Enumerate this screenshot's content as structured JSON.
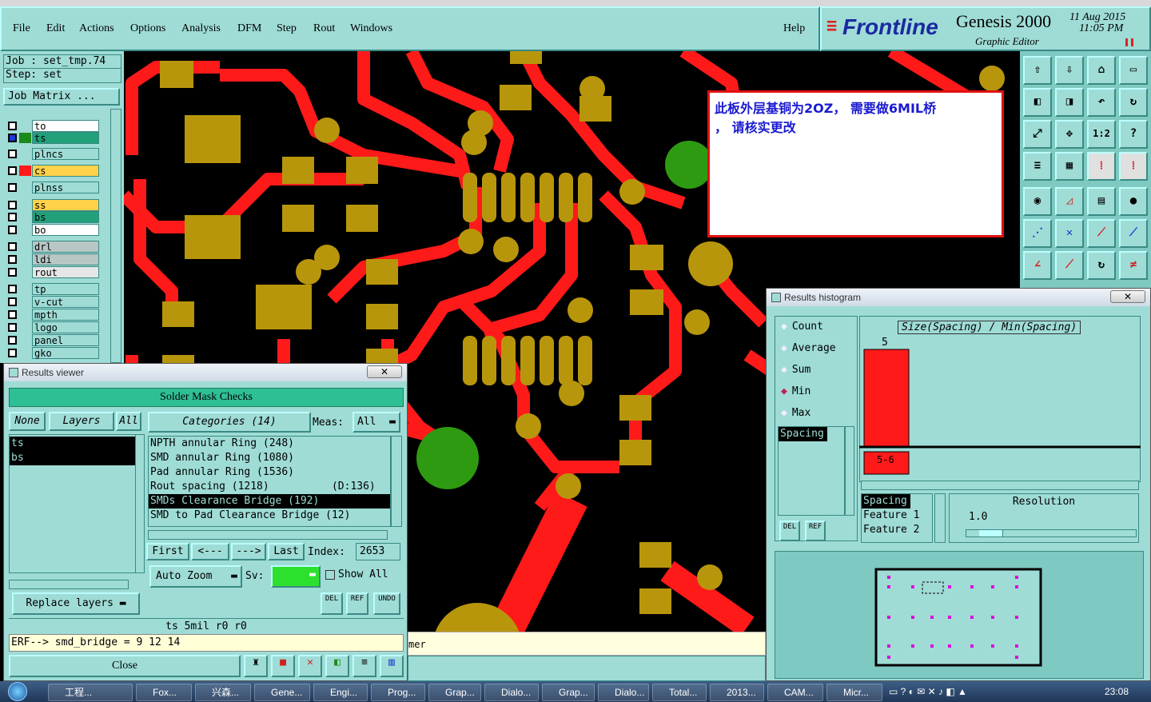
{
  "menu": {
    "file": "File",
    "edit": "Edit",
    "actions": "Actions",
    "options": "Options",
    "analysis": "Analysis",
    "dfm": "DFM",
    "step": "Step",
    "rout": "Rout",
    "windows": "Windows",
    "help": "Help"
  },
  "brand": {
    "logo": "Frontline",
    "product": "Genesis 2000",
    "subtitle": "Graphic Editor",
    "date": "11 Aug 2015",
    "time": "11:05 PM"
  },
  "left": {
    "job": "Job : set_tmp.74",
    "step": "Step: set",
    "job_matrix": "Job Matrix ...",
    "layers": [
      {
        "name": "to",
        "color": "#ffffff"
      },
      {
        "name": "ts",
        "color": "#22a07a"
      },
      {
        "name": "plncs",
        "color": "#9fdcd6"
      },
      {
        "name": "cs",
        "color": "#ffd24a"
      },
      {
        "name": "plnss",
        "color": "#9fdcd6"
      },
      {
        "name": "ss",
        "color": "#ffd24a"
      },
      {
        "name": "bs",
        "color": "#22a07a"
      },
      {
        "name": "bo",
        "color": "#ffffff"
      },
      {
        "name": "drl",
        "color": "#b8c6c6"
      },
      {
        "name": "ldi",
        "color": "#b8c6c6"
      },
      {
        "name": "rout",
        "color": "#e6e6e6"
      },
      {
        "name": "tp",
        "color": "#9fdcd6"
      },
      {
        "name": "v-cut",
        "color": "#9fdcd6"
      },
      {
        "name": "mpth",
        "color": "#9fdcd6"
      },
      {
        "name": "logo",
        "color": "#9fdcd6"
      },
      {
        "name": "panel",
        "color": "#9fdcd6"
      },
      {
        "name": "gko",
        "color": "#9fdcd6"
      }
    ]
  },
  "note": {
    "line1": "此板外层基铜为2OZ， 需要做6MIL桥",
    "line2": "， 请核实更改"
  },
  "results": {
    "title": "Results viewer",
    "close_x": "✕",
    "header": "Solder Mask Checks",
    "none": "None",
    "layers": "Layers",
    "all": "All",
    "categories": "Categories (14)",
    "meas_label": "Meas:",
    "meas_value": "All",
    "layer_list": [
      "ts",
      "bs"
    ],
    "category_list": [
      "NPTH annular Ring (248)",
      "SMD annular Ring (1080)",
      "Pad annular Ring (1536)",
      "Rout spacing (1218)          (D:136)",
      "SMDs Clearance Bridge (192)",
      "SMD to Pad Clearance Bridge (12)"
    ],
    "first": "First",
    "prev": "<---",
    "next": "--->",
    "last": "Last",
    "index_label": "Index:",
    "index_value": "2653",
    "auto_zoom": "Auto Zoom",
    "sv": "Sv:",
    "show_all": "Show All",
    "replace_layers": "Replace layers",
    "del": "DEL",
    "ref": "REF",
    "undo": "UNDO",
    "status": "ts  5mil   r0   r0",
    "erf": "ERF--> smd_bridge = 9 12 14",
    "close": "Close"
  },
  "partial_text": "mer",
  "histogram": {
    "title": "Results histogram",
    "close_x": "✕",
    "opts": [
      "Count",
      "Average",
      "Sum",
      "Min",
      "Max"
    ],
    "selected": "Min",
    "list_item": "Spacing",
    "graph_title": "Size(Spacing) / Min(Spacing)",
    "bar_value": "5",
    "bar_label": "5-6",
    "field_rows": [
      "Spacing",
      "Feature 1",
      "Feature 2"
    ],
    "resolution_label": "Resolution",
    "resolution_value": "1.0",
    "del": "DEL",
    "ref": "REF"
  },
  "taskbar": {
    "items": [
      "工程...",
      "Fox...",
      "兴森...",
      "Gene...",
      "Engi...",
      "Prog...",
      "Grap...",
      "Dialo...",
      "Grap...",
      "Dialo...",
      "Total...",
      "2013...",
      "CAM...",
      "Micr..."
    ],
    "clock": "23:08"
  },
  "colors": {
    "bg": "#9fdcd6",
    "trace": "#ff1a1a",
    "pad": "#b8960c",
    "hole": "#2e9a12"
  }
}
